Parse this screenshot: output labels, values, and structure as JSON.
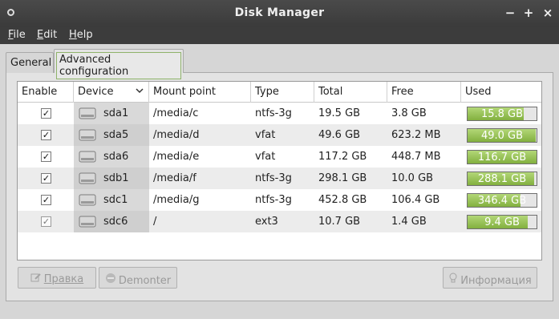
{
  "window": {
    "title": "Disk Manager",
    "controls": {
      "minimize": "−",
      "maximize": "+",
      "close": "×"
    }
  },
  "menu": {
    "items": [
      {
        "label": "File",
        "mnemonic": "F",
        "rest": "ile"
      },
      {
        "label": "Edit",
        "mnemonic": "E",
        "rest": "dit"
      },
      {
        "label": "Help",
        "mnemonic": "H",
        "rest": "elp"
      }
    ]
  },
  "tabs": [
    {
      "label": "General",
      "active": false
    },
    {
      "label": "Advanced configuration",
      "active": true
    }
  ],
  "table": {
    "columns": [
      "Enable",
      "Device",
      "Mount point",
      "Type",
      "Total",
      "Free",
      "Used"
    ],
    "sort_icon": "chevron-down-icon",
    "rows": [
      {
        "enabled": "✓",
        "device": "sda1",
        "mount": "/media/c",
        "type": "ntfs-3g",
        "total": "19.5 GB",
        "free": "3.8 GB",
        "used": "15.8 GB",
        "used_fraction": 0.81
      },
      {
        "enabled": "✓",
        "device": "sda5",
        "mount": "/media/d",
        "type": "vfat",
        "total": "49.6 GB",
        "free": "623.2 MB",
        "used": "49.0 GB",
        "used_fraction": 0.99
      },
      {
        "enabled": "✓",
        "device": "sda6",
        "mount": "/media/e",
        "type": "vfat",
        "total": "117.2 GB",
        "free": "448.7 MB",
        "used": "116.7 GB",
        "used_fraction": 0.996
      },
      {
        "enabled": "✓",
        "device": "sdb1",
        "mount": "/media/f",
        "type": "ntfs-3g",
        "total": "298.1 GB",
        "free": "10.0 GB",
        "used": "288.1 GB",
        "used_fraction": 0.97
      },
      {
        "enabled": "✓",
        "device": "sdc1",
        "mount": "/media/g",
        "type": "ntfs-3g",
        "total": "452.8 GB",
        "free": "106.4 GB",
        "used": "346.4 GB",
        "used_fraction": 0.77
      },
      {
        "enabled": "✓",
        "device": "sdc6",
        "mount": "/",
        "type": "ext3",
        "total": "10.7 GB",
        "free": "1.4 GB",
        "used": "9.4 GB",
        "used_fraction": 0.87,
        "disabled": true
      }
    ]
  },
  "buttons": {
    "edit": {
      "label": "Правка",
      "icon": "edit-icon"
    },
    "unmount": {
      "label": "Demonter",
      "icon": "minus-circle-icon"
    },
    "info": {
      "label": "Информация",
      "icon": "lightbulb-icon"
    }
  },
  "colors": {
    "titlebar": "#3b3b3b",
    "used_bar": "#82b03f",
    "tab_focus_border": "#8fb36a"
  }
}
